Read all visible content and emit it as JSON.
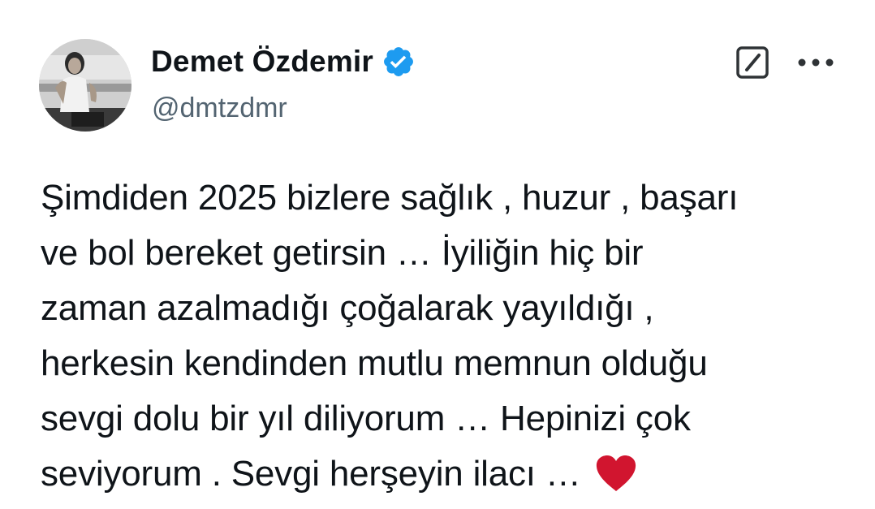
{
  "author": {
    "display_name": "Demet Özdemir",
    "handle": "@dmtzdmr",
    "verified": true,
    "verified_color": "#1d9bf0"
  },
  "actions": {
    "grok_icon": "slash-box-icon",
    "more_icon": "more-horizontal-icon"
  },
  "tweet": {
    "lines": [
      "Şimdiden 2025 bizlere sağlık , huzur , başarı",
      "ve bol bereket getirsin … İyiliğin hiç bir",
      "zaman azalmadığı çoğalarak yayıldığı ,",
      "herkesin kendinden mutlu memnun olduğu",
      "sevgi dolu bir yıl diliyorum … Hepinizi çok",
      "seviyorum . Sevgi herşeyin ilacı …"
    ],
    "emoji": "heart-icon",
    "emoji_color": "#d1152f"
  }
}
